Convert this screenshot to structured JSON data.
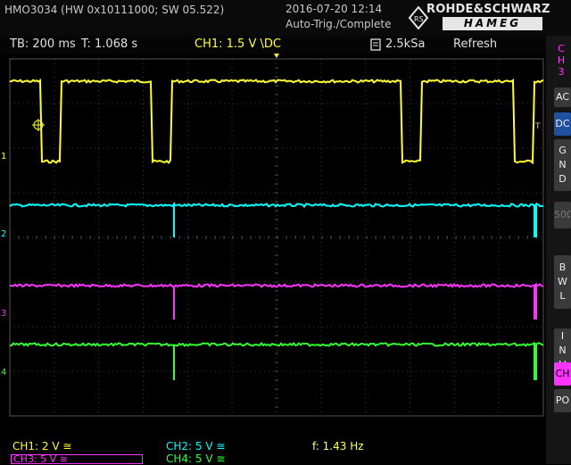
{
  "header": {
    "model": "HMO3034 (HW 0x10111000; SW 05.522)",
    "datetime": "2016-07-20 12:14",
    "trigger_status": "Auto-Trig./Complete",
    "brand_top": "ROHDE&SCHWARZ",
    "brand_bottom": "HAMEG"
  },
  "status": {
    "timebase": "TB: 200 ms",
    "trigger_time": "T: 1.068 s",
    "ch1_setting": "CH1: 1.5 V \\DC",
    "sample_rate": "2.5kSa",
    "mode": "Refresh"
  },
  "sidebar": {
    "channel": "CH3",
    "buttons": [
      "AC",
      "DC",
      "GND",
      "50Ω",
      "BWL",
      "INV",
      "CH",
      "PO"
    ],
    "active": "DC"
  },
  "markers": {
    "ch1": "1",
    "ch2": "2",
    "ch3": "3",
    "ch4": "4",
    "trigger": "T"
  },
  "footer": {
    "ch1": "CH1: 2 V ≅",
    "ch2": "CH2: 5 V ≅",
    "frequency": "f: 1.43 Hz",
    "ch3": "CH3: 5 V ≅",
    "ch4": "CH4: 5 V ≅"
  },
  "colors": {
    "ch1": "#ffff33",
    "ch2": "#00ffff",
    "ch3": "#ff33ff",
    "ch4": "#33ff33"
  },
  "waveforms": {
    "ch1_low_intervals_fraction": [
      [
        0.057,
        0.095
      ],
      [
        0.265,
        0.303
      ],
      [
        0.733,
        0.771
      ],
      [
        0.945,
        0.983
      ]
    ],
    "glitch_positions_fraction": [
      0.307,
      0.985
    ]
  }
}
